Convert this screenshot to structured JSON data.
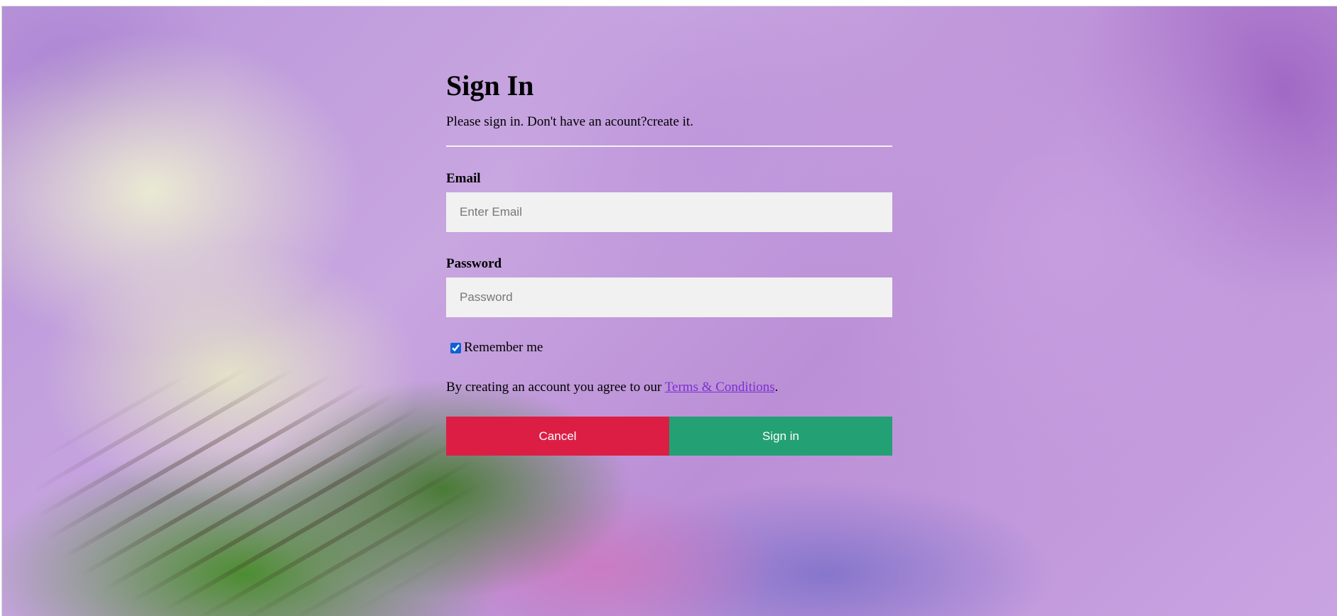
{
  "page": {
    "title": "Sign In",
    "subtitle": "Please sign in. Don't have an acount?create it."
  },
  "fields": {
    "email": {
      "label": "Email",
      "placeholder": "Enter Email",
      "value": ""
    },
    "password": {
      "label": "Password",
      "placeholder": "Password",
      "value": ""
    }
  },
  "remember": {
    "label": "Remember me",
    "checked": true
  },
  "terms": {
    "prefix": "By creating an account you agree to our ",
    "link": "Terms & Conditions",
    "suffix": "."
  },
  "buttons": {
    "cancel": "Cancel",
    "signin": "Sign in"
  },
  "colors": {
    "cancel": "#dc1e45",
    "signin": "#23a074",
    "input_bg": "#f1f1f1",
    "link": "#7b2fd0"
  }
}
